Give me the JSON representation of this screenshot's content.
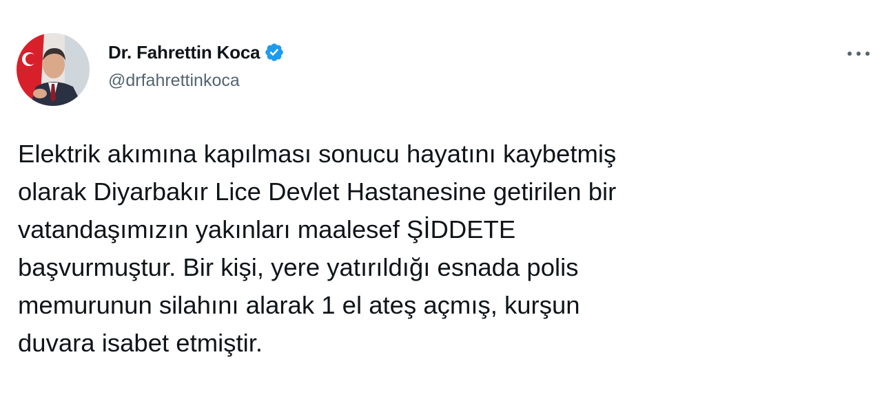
{
  "author": {
    "display_name": "Dr. Fahrettin Koca",
    "handle": "@drfahrettinkoca",
    "verified": true
  },
  "icons": {
    "verified": "verified-badge-icon",
    "more": "more-options-icon"
  },
  "colors": {
    "text": "#0f1419",
    "secondary": "#536471",
    "verified_blue": "#1d9bf0"
  },
  "tweet": {
    "text": "Elektrik akımına kapılması sonucu hayatını kaybetmiş\nolarak Diyarbakır Lice Devlet Hastanesine getirilen bir\nvatandaşımızın yakınları maalesef ŞİDDETE\nbaşvurmuştur. Bir kişi, yere yatırıldığı esnada polis\nmemurunun silahını alarak 1 el ateş açmış, kurşun\nduvara isabet etmiştir."
  }
}
